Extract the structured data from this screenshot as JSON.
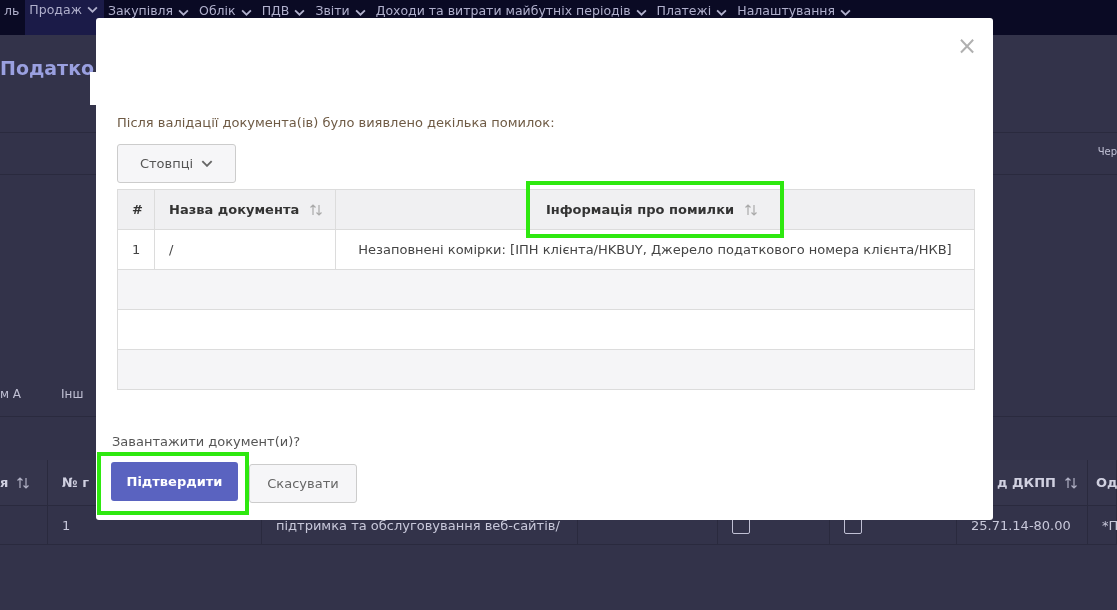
{
  "nav": {
    "items": [
      {
        "label": "ль",
        "selected": false,
        "has_menu": false
      },
      {
        "label": "Продаж",
        "selected": true,
        "has_menu": true
      },
      {
        "label": "Закупівля",
        "selected": false,
        "has_menu": true
      },
      {
        "label": "Облік",
        "selected": false,
        "has_menu": true
      },
      {
        "label": "ПДВ",
        "selected": false,
        "has_menu": true
      },
      {
        "label": "Звіти",
        "selected": false,
        "has_menu": true
      },
      {
        "label": "Доходи та витрати майбутніх періодів",
        "selected": false,
        "has_menu": true
      },
      {
        "label": "Платежі",
        "selected": false,
        "has_menu": true
      },
      {
        "label": "Налаштування",
        "selected": false,
        "has_menu": true
      }
    ]
  },
  "page": {
    "title": "Податко",
    "corner_label": "Чер",
    "tabs": [
      "м А",
      "Інш"
    ],
    "table": {
      "columns": [
        {
          "label": "я",
          "sortable": true
        },
        {
          "label": "№ г",
          "sortable": false
        },
        {},
        {},
        {},
        {},
        {
          "label": "д ДКПП",
          "sortable": true
        },
        {
          "label": "Од",
          "sortable": false
        }
      ],
      "rows": [
        {
          "cells": [
            {
              "kind": "empty"
            },
            {
              "kind": "text",
              "text": "1"
            },
            {
              "kind": "text",
              "text": "підтримка та обслуговування веб-сайтів/"
            },
            {
              "kind": "empty"
            },
            {
              "kind": "checkbox",
              "checked": false
            },
            {
              "kind": "checkbox",
              "checked": false
            },
            {
              "kind": "text",
              "text": "25.71.14-80.00"
            },
            {
              "kind": "text",
              "text": "*П"
            }
          ]
        }
      ]
    }
  },
  "dialog": {
    "close": "×",
    "message": "Після валідації документа(ів) було виявлено декілька помилок:",
    "columns_button": "Стовпці",
    "table": {
      "columns": [
        {
          "label": "#",
          "sortable": false,
          "highlighted": false
        },
        {
          "label": "Назва документа",
          "sortable": true,
          "highlighted": false
        },
        {
          "label": "Інформація про помилки",
          "sortable": true,
          "highlighted": true
        }
      ],
      "rows": [
        {
          "cells": [
            "1",
            "/",
            "Незаповнені комірки: [ІПН клієнта/HKBUY, Джерело податкового номера клієнта/НКВ]"
          ]
        }
      ]
    },
    "question": "Завантажити документ(и)?",
    "buttons": [
      {
        "label": "Підтвердити",
        "kind": "primary",
        "highlighted": true
      },
      {
        "label": "Скасувати",
        "kind": "secondary",
        "highlighted": false
      }
    ]
  }
}
